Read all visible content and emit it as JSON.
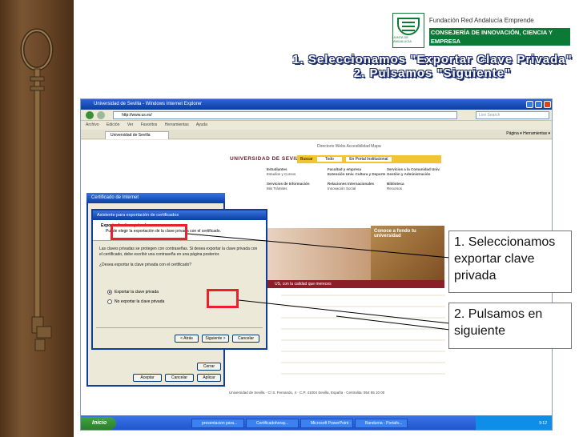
{
  "brand": {
    "emblem_text": "JUNTA DE ANDALUCÍA",
    "line1": "Fundación Red Andalucía Emprende",
    "line2": "CONSEJERÍA DE INNOVACIÓN, CIENCIA Y EMPRESA"
  },
  "headline": {
    "step1": "1. Seleccionamos \"Exportar Clave Privada\"",
    "step2": "2. Pulsamos \"Siguiente\""
  },
  "browser": {
    "title": "Universidad de Sevilla - Windows Internet Explorer",
    "url": "http://www.us.es/",
    "search_placeholder": "Live Search",
    "menu": "Archivo Edición Ver Favoritos Herramientas Ayuda",
    "tab": "Universidad de Sevilla",
    "toolbar_right": "Página ▾  Herramientas ▾"
  },
  "website": {
    "logo": "UNIVERSIDAD DE SEVILLA",
    "search_label": "Buscar",
    "search_value": "Todo",
    "search_button": "En Portal Institucional",
    "top_nav": "Directorio  Webs  Accesibilidad  Mapa",
    "col1": [
      "Estudiantes",
      "Estudios y Cursos",
      "Servicios de Información",
      "Mis Trámites"
    ],
    "col2": [
      "Facultad y empresa",
      "Extensión Univ. Cultura y Deporte",
      "Relaciones Internacionales",
      "Innovación Social"
    ],
    "col3": [
      "Servicios a la Comunidad Univ.",
      "Gestión y Administración",
      "Biblioteca",
      "Recursos"
    ],
    "banner_title": "Conoce a fondo tu universidad",
    "banner_bar": "US, con la calidad que mereces",
    "footer": "Universidad de Sevilla · C/ S. Fernando, 4 · C.P. 41004 Sevilla, España · Centralita: 954 55 10 00"
  },
  "dialog_cert": {
    "title": "Certificado de Internet",
    "buttons": [
      "Aceptar",
      "Cancelar",
      "Aplicar"
    ]
  },
  "dialog_wizard": {
    "title": "Asistente para exportación de certificados",
    "header_title": "Exportar la clave privada",
    "header_desc": "Puede elegir la exportación de la clave privada con el certificado.",
    "body_text": "Las claves privadas se protegen con contraseñas. Si desea exportar la clave privada con el certificado, debe escribir una contraseña en una página posterior.",
    "question": "¿Desea exportar la clave privada con el certificado?",
    "option_yes": "Exportar la clave privada",
    "option_no": "No exportar la clave privada",
    "btn_back": "< Atrás",
    "btn_next": "Siguiente >",
    "btn_cancel": "Cancelar",
    "btn_close": "Cerrar"
  },
  "taskbar": {
    "start": "Inicio",
    "items": [
      "presentacion para...",
      "Certificadohoray...",
      "Microsoft PowerPoint - ...",
      "Bandurria - Portafo..."
    ],
    "clock": "9:12"
  },
  "callouts": {
    "c1": "1. Seleccionamos exportar clave privada",
    "c2": "2. Pulsamos en siguiente"
  },
  "colors": {
    "highlight": "#e8222b",
    "headline_outline": "#1a2b6b",
    "xp_blue": "#0a3ea0",
    "junta_green": "#0a7a36"
  }
}
